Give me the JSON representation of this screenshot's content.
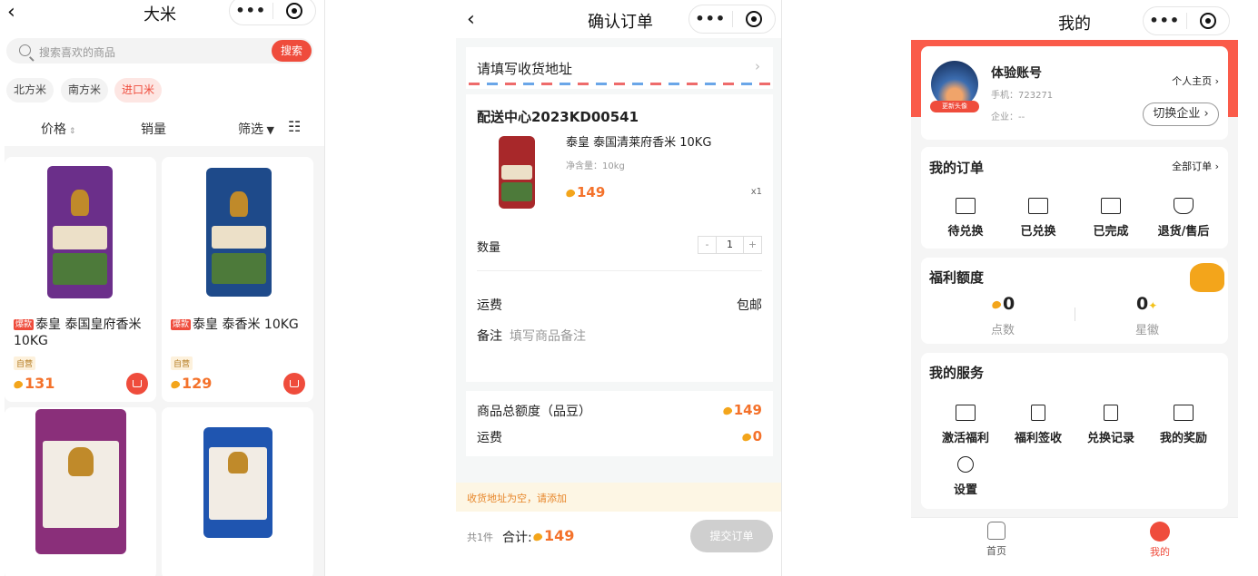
{
  "panel1": {
    "title": "大米",
    "search_placeholder": "搜索喜欢的商品",
    "search_button": "搜索",
    "chips": [
      "北方米",
      "南方米",
      "进口米"
    ],
    "active_chip": "进口米",
    "sort": {
      "price": "价格",
      "sales": "销量",
      "filter": "筛选"
    },
    "products": [
      {
        "hot": "爆款",
        "name": "泰皇 泰国皇府香米10KG",
        "tag": "自营",
        "price": "131",
        "bag_color": "#6b2f8a"
      },
      {
        "hot": "爆款",
        "name": "泰皇 泰香米 10KG",
        "tag": "自营",
        "price": "129",
        "bag_color": "#1e4a8a"
      },
      {
        "bag_color": "#8a2f7a"
      },
      {
        "bag_color": "#1f55b0"
      }
    ]
  },
  "panel2": {
    "title": "确认订单",
    "address_prompt": "请填写收货地址",
    "center_name": "配送中心2023KD00541",
    "item": {
      "name": "泰皇 泰国清莱府香米 10KG",
      "spec": "净含量：10kg",
      "price": "149",
      "qty_text": "x1"
    },
    "quantity_label": "数量",
    "quantity_value": "1",
    "minus": "-",
    "plus": "+",
    "shipping_label": "运费",
    "shipping_value": "包邮",
    "remark_label": "备注",
    "remark_placeholder": "填写商品备注",
    "total_label": "商品总额度（品豆）",
    "total_value": "149",
    "fee_label": "运费",
    "fee_value": "0",
    "tip": "收货地址为空，请添加",
    "count_text": "共1件",
    "sum_label": "合计:",
    "sum_value": "149",
    "submit": "提交订单"
  },
  "panel3": {
    "title": "我的",
    "avatar_badge": "更新头像",
    "account_name": "体验账号",
    "phone": "手机：723271",
    "company": "企业：--",
    "home_link": "个人主页",
    "switch_company": "切换企业",
    "orders_title": "我的订单",
    "orders_all": "全部订单",
    "orders": [
      "待兑换",
      "已兑换",
      "已完成",
      "退货/售后"
    ],
    "welfare_title": "福利额度",
    "points_value": "0",
    "points_label": "点数",
    "stars_value": "0",
    "stars_label": "星徽",
    "services_title": "我的服务",
    "services": [
      "激活福利",
      "福利签收",
      "兑换记录",
      "我的奖励",
      "设置"
    ],
    "tabs": [
      "首页",
      "我的"
    ],
    "active_tab": "我的"
  },
  "colors": {
    "accent": "#ef4c3c",
    "price": "#f4722b",
    "bean": "#f3a51b"
  }
}
